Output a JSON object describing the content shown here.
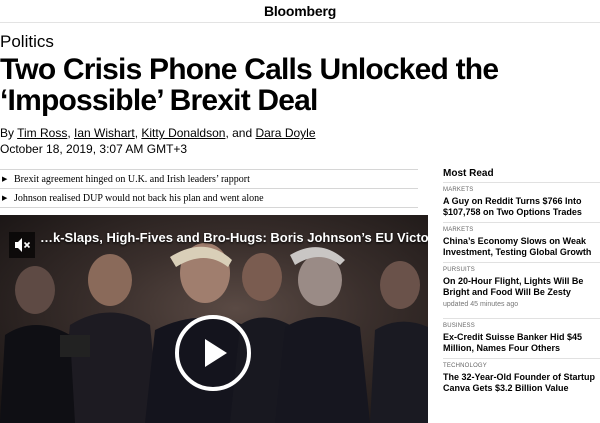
{
  "brand": "Bloomberg",
  "article": {
    "section": "Politics",
    "headline": "Two Crisis Phone Calls Unlocked the ‘Impossible’ Brexit Deal",
    "by": "By ",
    "authors": [
      "Tim Ross",
      "Ian Wishart",
      "Kitty Donaldson",
      "Dara Doyle"
    ],
    "sep": ", ",
    "sep_and": ", and ",
    "date": "October 18, 2019, 3:07 AM GMT+3",
    "bullets": [
      "Brexit agreement hinged on U.K. and Irish leaders’ rapport",
      "Johnson realised DUP would not back his plan and went alone"
    ]
  },
  "video": {
    "title": "…k-Slaps, High-Fives and Bro-Hugs: Boris Johnson’s EU Victory",
    "mute_icon": "mute-icon",
    "play_icon": "play-icon"
  },
  "most_read": {
    "heading": "Most Read",
    "stories": [
      {
        "category": "Markets",
        "title": "A Guy on Reddit Turns $766 Into $107,758 on Two Options Trades",
        "ago": ""
      },
      {
        "category": "Markets",
        "title": "China’s Economy Slows on Weak Investment, Testing Global Growth",
        "ago": ""
      },
      {
        "category": "Pursuits",
        "title": "On 20-Hour Flight, Lights Will Be Bright and Food Will Be Zesty",
        "ago": "updated 45 minutes ago"
      },
      {
        "category": "Business",
        "title": "Ex-Credit Suisse Banker Hid $45 Million, Names Four Others",
        "ago": ""
      },
      {
        "category": "Technology",
        "title": "The 32-Year-Old Founder of Startup Canva Gets $3.2 Billion Value",
        "ago": ""
      }
    ]
  },
  "colors": {
    "text": "#000000",
    "muted": "#666666",
    "divider": "#d6d6d6"
  }
}
